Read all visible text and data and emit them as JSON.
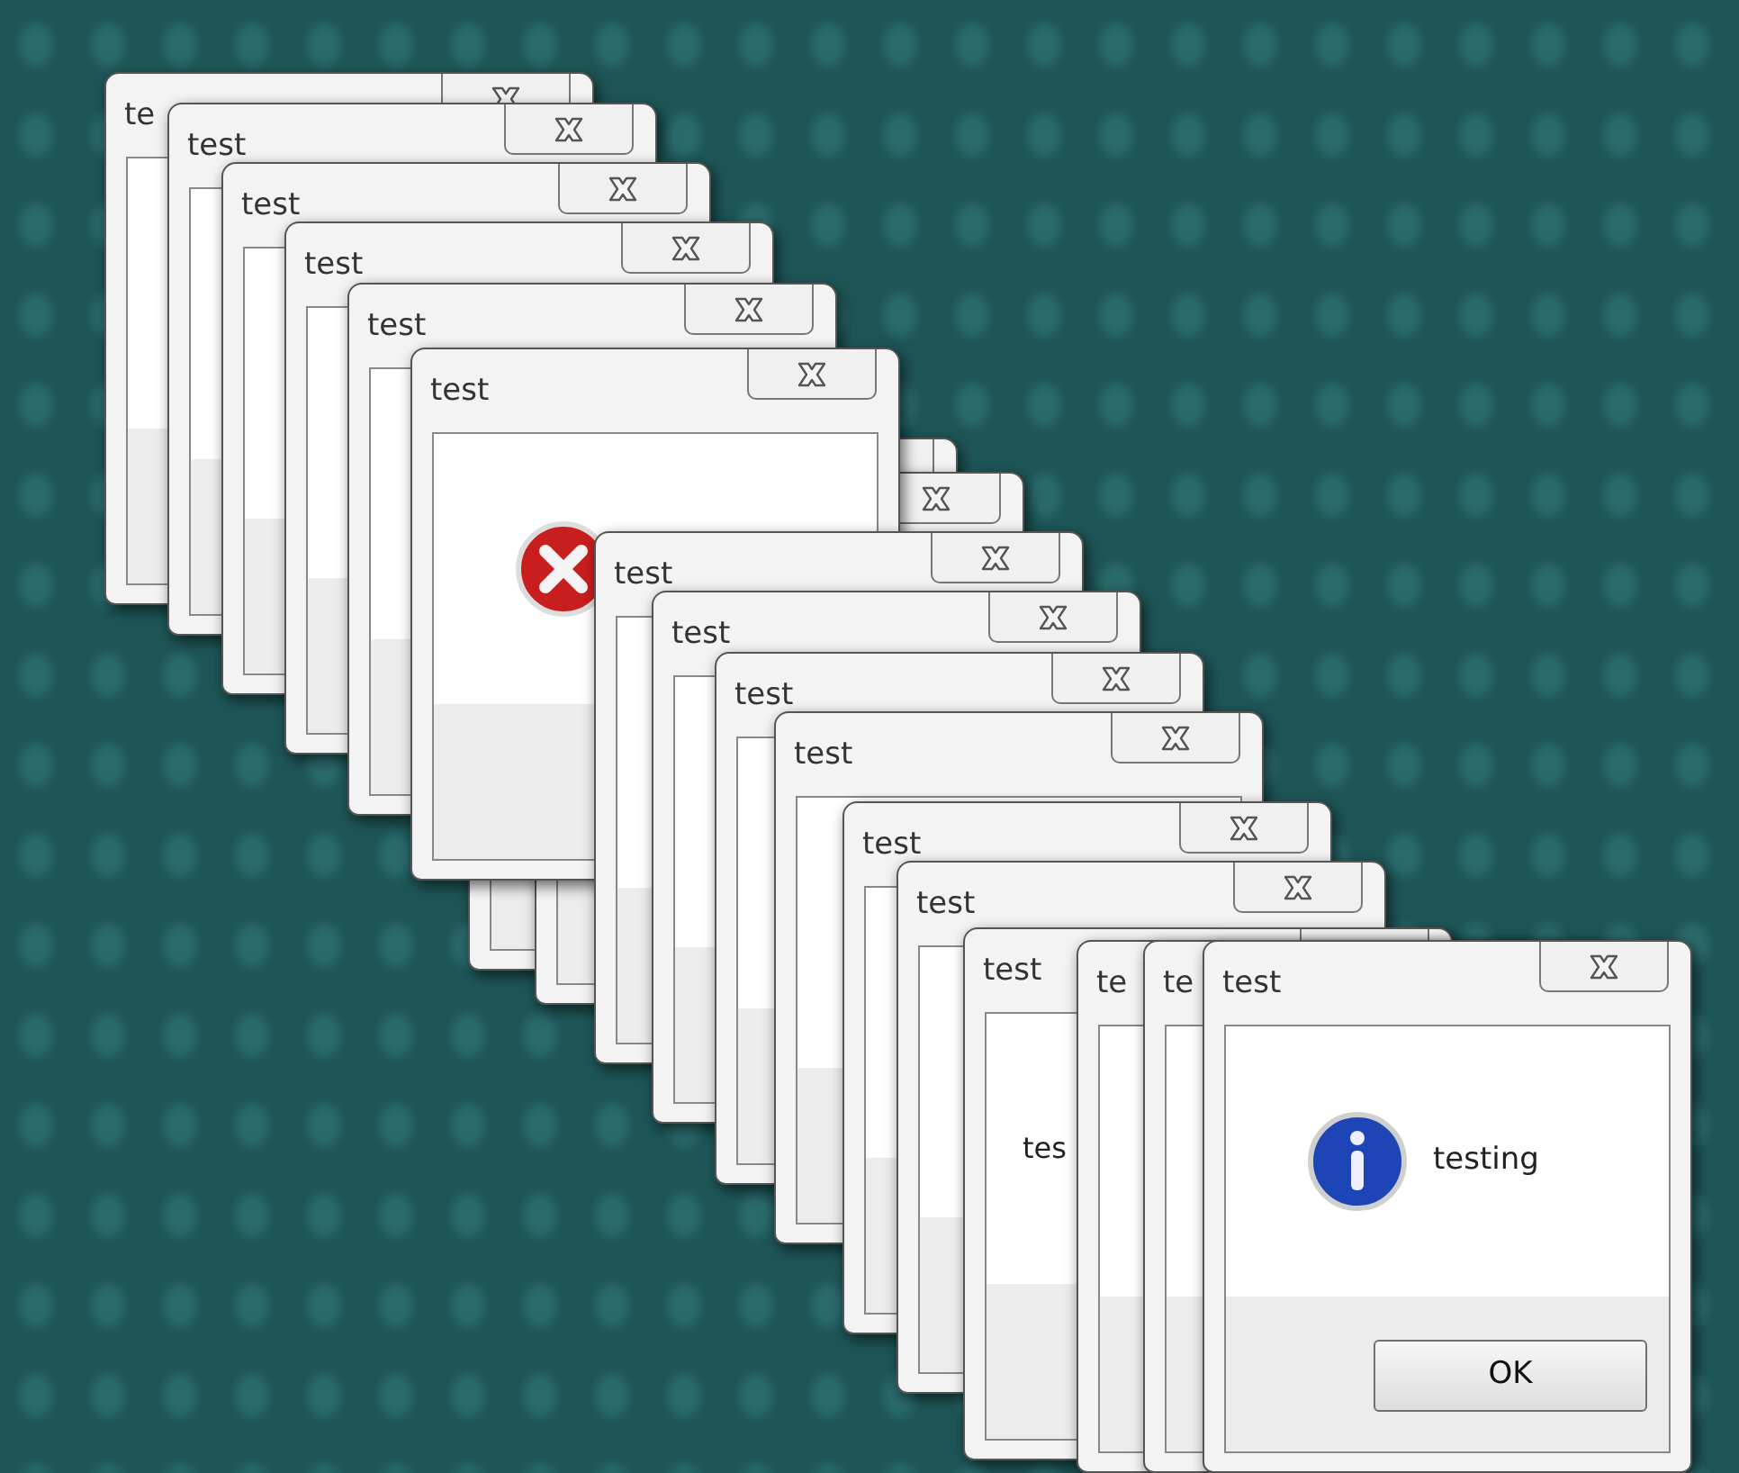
{
  "windows": [
    {
      "title": "te",
      "kind": "plain"
    },
    {
      "title": "test",
      "kind": "plain"
    },
    {
      "title": "test",
      "kind": "plain"
    },
    {
      "title": "test",
      "kind": "plain"
    },
    {
      "title": "test",
      "kind": "plain"
    },
    {
      "kind": "plain"
    },
    {
      "kind": "plain"
    },
    {
      "title": "test",
      "kind": "error"
    },
    {
      "title": "test",
      "kind": "plain"
    },
    {
      "title": "test",
      "kind": "plain"
    },
    {
      "title": "test",
      "kind": "plain"
    },
    {
      "title": "test",
      "kind": "plain"
    },
    {
      "title": "test",
      "kind": "plain"
    },
    {
      "title": "test",
      "kind": "plain"
    },
    {
      "title": "test",
      "kind": "plain",
      "message": "tes"
    },
    {
      "title": "te",
      "kind": "plain"
    },
    {
      "title": "te",
      "kind": "plain"
    },
    {
      "title": "test",
      "kind": "info",
      "message": "testing",
      "button": "OK"
    }
  ]
}
